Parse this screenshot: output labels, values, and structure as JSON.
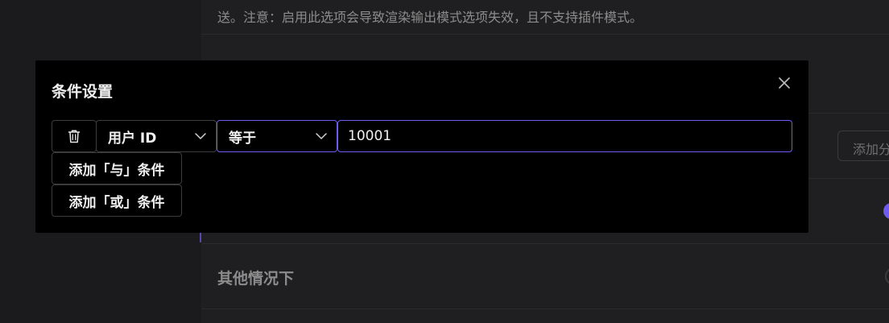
{
  "background": {
    "note": "送。注意：启用此选项会导致渲染输出模式选项失效，且不支持插件模式。",
    "add_button_label": "添加分",
    "other_cases_label": "其他情况下"
  },
  "modal": {
    "title": "条件设置",
    "close_icon": "close-icon",
    "condition": {
      "delete_icon": "trash-icon",
      "field_select": {
        "selected": "用户 ID"
      },
      "operator_select": {
        "selected": "等于"
      },
      "value_input": {
        "value": "10001"
      }
    },
    "add_and_label": "添加「与」条件",
    "add_or_label": "添加「或」条件"
  },
  "colors": {
    "accent": "#6e5cf0",
    "modal_bg": "#000000",
    "page_bg": "#1b1b1d"
  }
}
